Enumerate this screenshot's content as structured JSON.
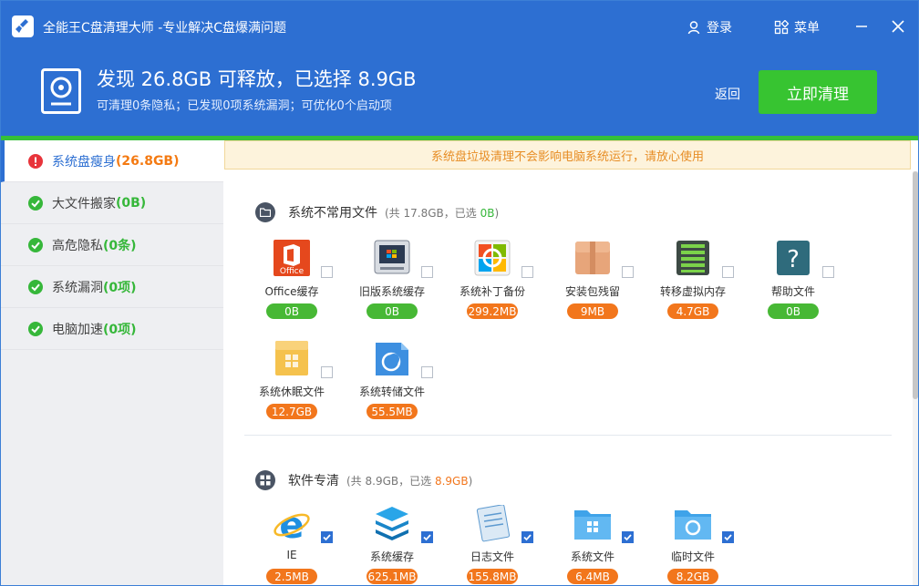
{
  "app": {
    "title": "全能王C盘清理大师 -专业解决C盘爆满问题",
    "login_label": "登录",
    "menu_label": "菜单"
  },
  "header": {
    "headline": "发现 26.8GB 可释放，已选择 8.9GB",
    "subline": "可清理0条隐私；已发现0项系统漏洞；可优化0个启动项",
    "back_label": "返回",
    "clean_label": "立即清理"
  },
  "sidebar": {
    "items": [
      {
        "label": "系统盘瘦身",
        "count": "(26.8GB)",
        "status": "warning",
        "active": true
      },
      {
        "label": "大文件搬家",
        "count": "(0B)",
        "status": "ok",
        "active": false
      },
      {
        "label": "高危隐私",
        "count": "(0条)",
        "status": "ok",
        "active": false
      },
      {
        "label": "系统漏洞",
        "count": "(0项)",
        "status": "ok",
        "active": false
      },
      {
        "label": "电脑加速",
        "count": "(0项)",
        "status": "ok",
        "active": false
      }
    ]
  },
  "notice": "系统盘垃圾清理不会影响电脑系统运行，请放心使用",
  "sections": [
    {
      "title": "系统不常用文件",
      "meta_prefix": "(共 17.8GB，已选 ",
      "meta_selected": "0B",
      "meta_suffix": ")",
      "items": [
        {
          "label": "Office缓存",
          "size": "0B",
          "checked": false,
          "icon": "office-icon"
        },
        {
          "label": "旧版系统缓存",
          "size": "0B",
          "checked": false,
          "icon": "old-system-icon"
        },
        {
          "label": "系统补丁备份",
          "size": "299.2MB",
          "checked": false,
          "icon": "patch-backup-icon"
        },
        {
          "label": "安装包残留",
          "size": "9MB",
          "checked": false,
          "icon": "package-box-icon"
        },
        {
          "label": "转移虚拟内存",
          "size": "4.7GB",
          "checked": false,
          "icon": "memory-chip-icon"
        },
        {
          "label": "帮助文件",
          "size": "0B",
          "checked": false,
          "icon": "help-file-icon"
        },
        {
          "label": "系统休眠文件",
          "size": "12.7GB",
          "checked": false,
          "icon": "hibernate-folder-icon"
        },
        {
          "label": "系统转储文件",
          "size": "55.5MB",
          "checked": false,
          "icon": "dump-file-icon"
        }
      ]
    },
    {
      "title": "软件专清",
      "meta_prefix": "(共 8.9GB，已选 ",
      "meta_selected": "8.9GB",
      "meta_suffix": ")",
      "items": [
        {
          "label": "IE",
          "size": "2.5MB",
          "checked": true,
          "icon": "ie-icon"
        },
        {
          "label": "系统缓存",
          "size": "625.1MB",
          "checked": true,
          "icon": "layers-icon"
        },
        {
          "label": "日志文件",
          "size": "155.8MB",
          "checked": true,
          "icon": "log-notebook-icon"
        },
        {
          "label": "系统文件",
          "size": "6.4MB",
          "checked": true,
          "icon": "windows-folder-icon"
        },
        {
          "label": "临时文件",
          "size": "8.2GB",
          "checked": true,
          "icon": "temp-folder-icon"
        }
      ]
    }
  ],
  "colors": {
    "brand_blue": "#2d6fd2",
    "clean_green": "#37c431",
    "size_green": "#47b835",
    "size_orange": "#f2761c",
    "notice_text": "#e78d25"
  }
}
